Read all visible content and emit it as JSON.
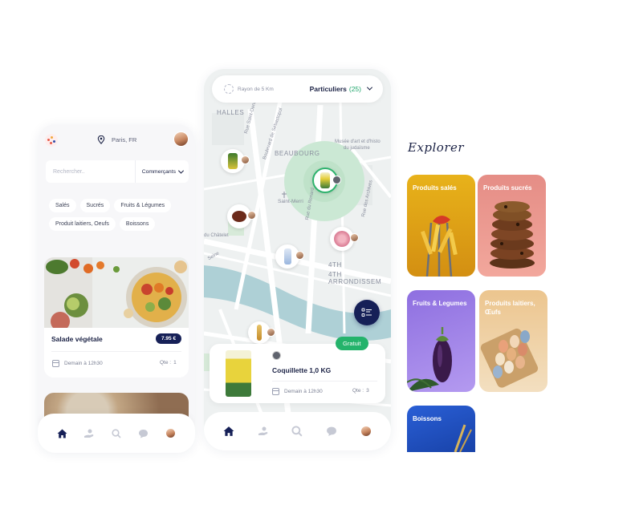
{
  "phone1": {
    "location": "Paris, FR",
    "search": {
      "placeholder": "Rechercher..",
      "filter": "Commerçants"
    },
    "categories": [
      "Salés",
      "Sucrés",
      "Fruits & Légumes",
      "Produit laitiers, Oeufs",
      "Boissons"
    ],
    "product": {
      "title": "Salade végétale",
      "price": "7.95 €",
      "pickup": "Demain à 12h30",
      "qty_label": "Qte :",
      "qty": "1"
    }
  },
  "phone2": {
    "radius_label": "Rayon de 5 Km",
    "filter_label": "Particuliers",
    "filter_count": "(25)",
    "map_labels": {
      "halles": "HALLES",
      "beaubourg": "BEAUBOURG",
      "saint_merri": "Saint-Merri",
      "arrondissement": "4TH ARRONDISSEM",
      "chatelet": "du Châtelet",
      "museum_line1": "Musée d'art et d'histo",
      "museum_line2": "du judaïsme",
      "street_saint_denis": "Rue Saint-Denis",
      "street_sebastopol": "Boulevard de Sébastopol",
      "street_renard": "Rue du Renard",
      "street_archives": "Rue des Archives",
      "street_seine": "Seine"
    },
    "product": {
      "badge": "Gratuit",
      "name": "Coquillette 1,0 KG",
      "pickup": "Demain à 12h30",
      "qty_label": "Qte :",
      "qty": "3"
    }
  },
  "explorer": {
    "title": "Explorer",
    "tiles": [
      {
        "label": "Produits salés"
      },
      {
        "label": "Produits sucrés"
      },
      {
        "label": "Fruits & Legumes"
      },
      {
        "label": "Produits laitiers, Œufs"
      },
      {
        "label": "Boissons"
      }
    ]
  },
  "colors": {
    "navy": "#162057",
    "green": "#24b36b",
    "map_water": "#aed0d6",
    "map_land": "#eef1f1"
  },
  "icons": [
    "logo-icon",
    "location-pin-icon",
    "chevron-down-icon",
    "home-icon",
    "hand-heart-icon",
    "search-icon",
    "chat-icon",
    "calendar-icon",
    "list-icon",
    "radius-icon"
  ]
}
